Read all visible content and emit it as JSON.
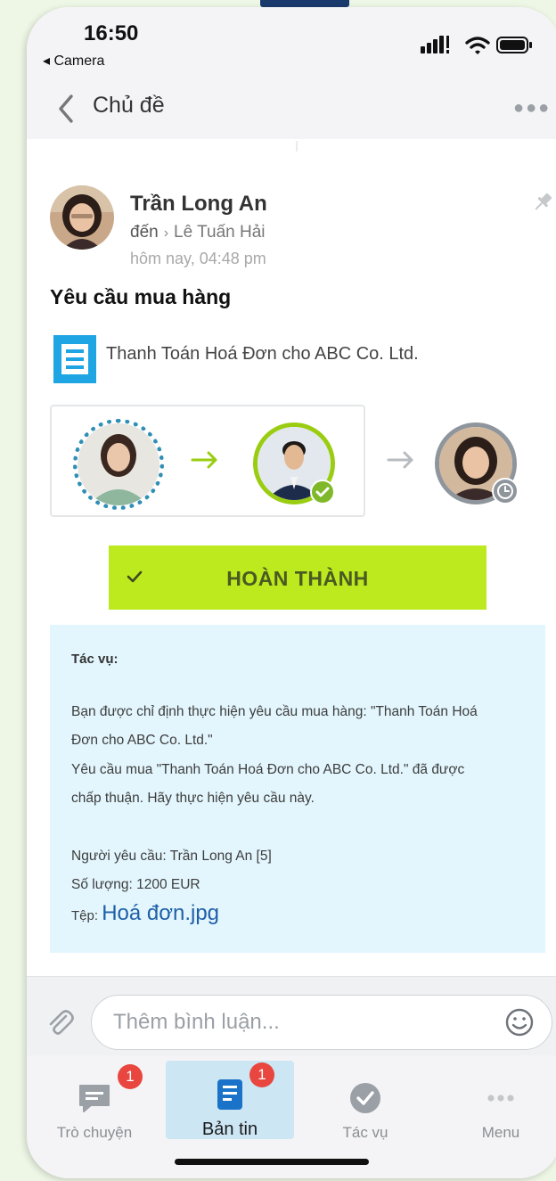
{
  "status_bar": {
    "time": "16:50",
    "back_app": "◂ Camera"
  },
  "nav": {
    "title": "Chủ đề"
  },
  "post": {
    "author": "Trần Long An",
    "to_prefix": "đến",
    "to_name": "Lê Tuấn Hải",
    "time": "hôm nay, 04:48 pm",
    "title": "Yêu cầu mua hàng",
    "document_title": "Thanh Toán Hoá Đơn cho ABC Co. Ltd.",
    "complete_button": "HOÀN THÀNH"
  },
  "task": {
    "heading": "Tác vụ:",
    "line1": "Bạn được chỉ định thực hiện yêu cầu mua hàng: \"Thanh Toán Hoá",
    "line2": "Đơn cho ABC Co. Ltd.\"",
    "line3": "Yêu cầu mua \"Thanh Toán Hoá Đơn cho ABC Co. Ltd.\" đã được",
    "line4": "chấp thuận. Hãy thực hiện yêu cầu này.",
    "requester": "Người yêu cầu: Trần Long An [5]",
    "amount": "Số lượng: 1200 EUR",
    "file_label": "Tệp: ",
    "file_link": "Hoá đơn.jpg"
  },
  "comment": {
    "placeholder": "Thêm bình luận..."
  },
  "tabs": [
    {
      "label": "Trò chuyện",
      "badge": "1",
      "icon": "chat-icon"
    },
    {
      "label": "Bản tin",
      "badge": "1",
      "icon": "newsfeed-icon"
    },
    {
      "label": "Tác vụ",
      "icon": "task-check-icon"
    },
    {
      "label": "Menu",
      "icon": "more-dots-icon"
    }
  ],
  "colors": {
    "accent_green": "#bdea1f",
    "task_bg": "#e3f6fd",
    "link_blue": "#1f5fa8",
    "badge_red": "#e8463e",
    "active_tab_bg": "#cce6f4"
  }
}
